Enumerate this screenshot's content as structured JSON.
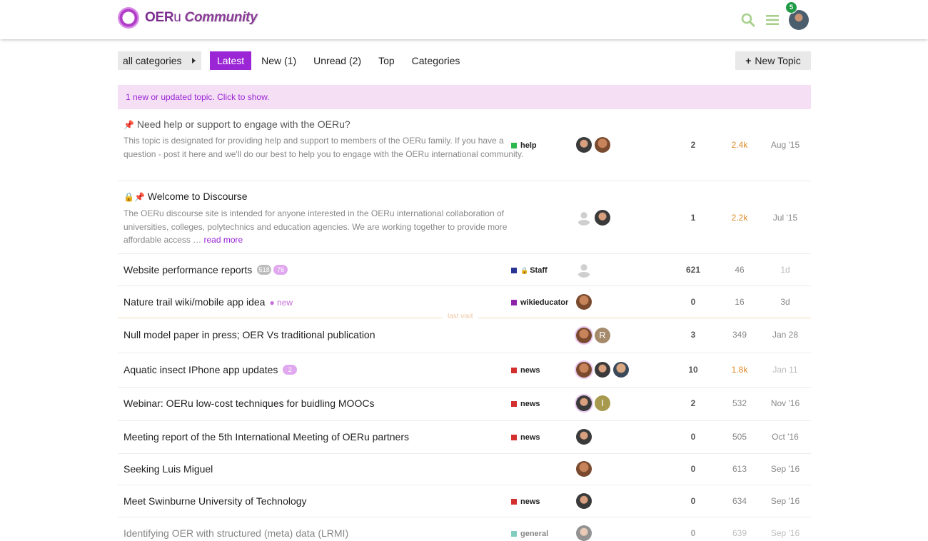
{
  "header": {
    "logo_main": "OER",
    "logo_u": "u",
    "logo_community": "Community",
    "notification_count": "5"
  },
  "nav": {
    "categories_dropdown": "all categories",
    "pills": [
      "Latest",
      "New (1)",
      "Unread (2)",
      "Top",
      "Categories"
    ],
    "new_topic": "New Topic"
  },
  "banner": "1 new or updated topic. Click to show.",
  "last_visit_label": "last visit",
  "colors": {
    "accent": "#9b26d6",
    "hot_views": "#dd8a26"
  },
  "topics": [
    {
      "title": "Need help or support to engage with the OERu?",
      "excerpt": "This topic is designated for providing help and support to members of the OERu family. If you have a question - post it here and we'll do our best to help you to engage with the OERu international community.",
      "category": "help",
      "replies": "2",
      "views": "2.4k",
      "activity": "Aug '15"
    },
    {
      "title": "Welcome to Discourse",
      "excerpt": "The OERu discourse site is intended for anyone interested in the OERu international collaboration of universities, colleges, polytechnics and education agencies. We are working together to provide more affordable access …",
      "read_more": "read more",
      "replies": "1",
      "views": "2.2k",
      "activity": "Jul '15"
    },
    {
      "title": "Website performance reports",
      "badge_unread": "518",
      "badge_new": "76",
      "category": "Staff",
      "replies": "621",
      "views": "46",
      "activity": "1d"
    },
    {
      "title": "Nature trail wiki/mobile app idea",
      "new_label": "new",
      "category": "wikieducator",
      "replies": "0",
      "views": "16",
      "activity": "3d"
    },
    {
      "title": "Null model paper in press; OER Vs traditional publication",
      "poster_letter": "R",
      "replies": "3",
      "views": "349",
      "activity": "Jan 28"
    },
    {
      "title": "Aquatic insect IPhone app updates",
      "badge_new": "2",
      "category": "news",
      "replies": "10",
      "views": "1.8k",
      "activity": "Jan 11"
    },
    {
      "title": "Webinar: OERu low-cost techniques for buidling MOOCs",
      "category": "news",
      "poster_letter": "I",
      "replies": "2",
      "views": "532",
      "activity": "Nov '16"
    },
    {
      "title": "Meeting report of the 5th International Meeting of OERu partners",
      "category": "news",
      "replies": "0",
      "views": "505",
      "activity": "Oct '16"
    },
    {
      "title": "Seeking Luis Miguel",
      "replies": "0",
      "views": "613",
      "activity": "Sep '16"
    },
    {
      "title": "Meet Swinburne University of Technology",
      "category": "news",
      "replies": "0",
      "views": "634",
      "activity": "Sep '16"
    },
    {
      "title": "Identifying OER with structured (meta) data (LRMI)",
      "category": "general",
      "replies": "0",
      "views": "639",
      "activity": "Sep '16"
    }
  ]
}
